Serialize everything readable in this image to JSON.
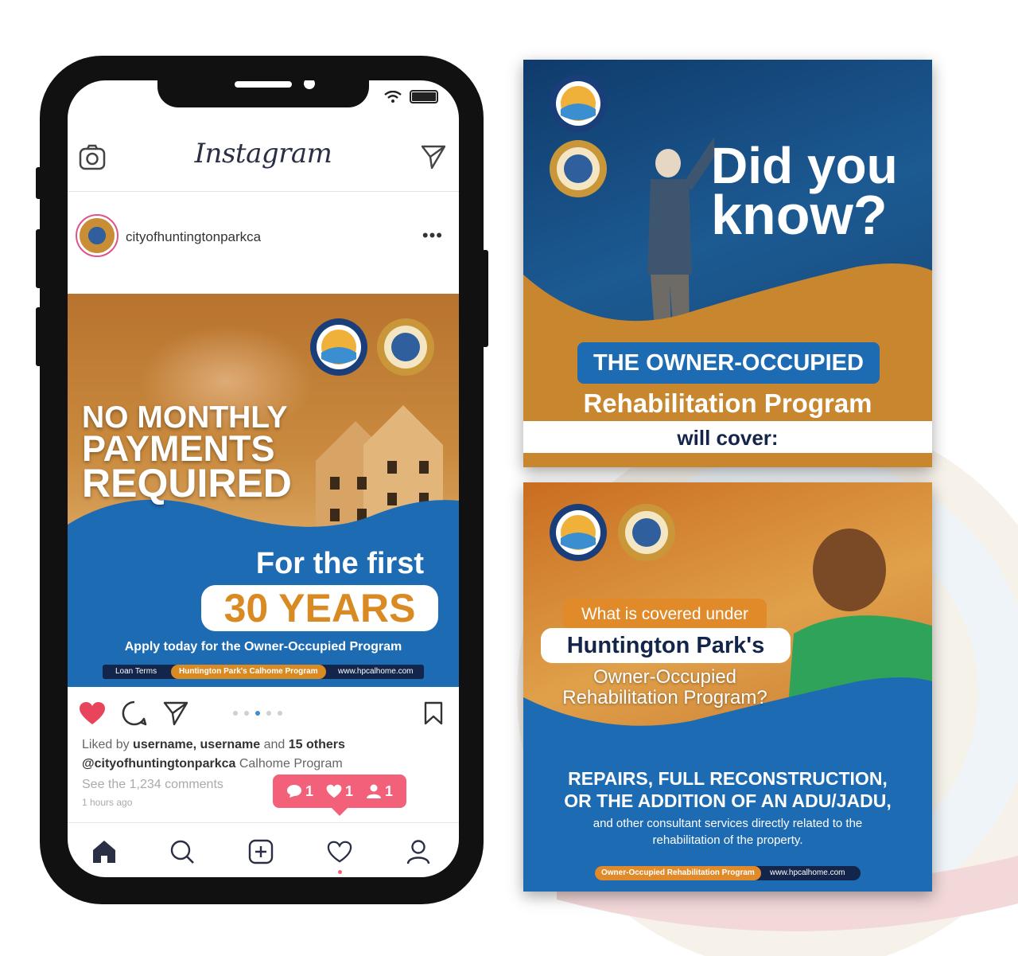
{
  "colors": {
    "brand_blue": "#1d6bb3",
    "brand_orange": "#d98a22",
    "navy": "#13254a",
    "notif_pink": "#f2607a",
    "like_red": "#e8455d"
  },
  "instagram": {
    "logo": "Instagram",
    "username": "cityofhuntingtonparkca",
    "more_icon": "more-dots-icon"
  },
  "post": {
    "title_line1": "NO MONTHLY",
    "title_line2": "PAYMENTS",
    "title_line3": "REQUIRED",
    "for_the_first": "For the first",
    "years": "30 YEARS",
    "apply": "Apply today for the Owner-Occupied Program",
    "footer": [
      "Loan Terms",
      "Huntington Park's Calhome Program",
      "www.hpcalhome.com"
    ]
  },
  "engagement": {
    "liked_prefix": "Liked by ",
    "liked_users": "username, username",
    "liked_and": " and ",
    "liked_others": "15 others",
    "caption_user": "@cityofhuntingtonparkca",
    "caption_text": " Calhome Program",
    "comments": "See the 1,234 comments",
    "time": "1 hours ago",
    "carousel_active_index": 2,
    "notif_comments": "1",
    "notif_likes": "1",
    "notif_follows": "1"
  },
  "card1": {
    "headline_1": "Did you",
    "headline_2": "know?",
    "pill": "THE OWNER-OCCUPIED",
    "subhead": "Rehabilitation Program",
    "cover": "will cover:"
  },
  "card2": {
    "pill1": "What is covered under",
    "pill2": "Huntington Park's",
    "sub_1": "Owner-Occupied",
    "sub_2": "Rehabilitation Program?",
    "repairs_1": "REPAIRS, FULL RECONSTRUCTION,",
    "repairs_2": "OR THE ADDITION OF AN ADU/JADU,",
    "other_1": "and other consultant services directly related to the",
    "other_2": "rehabilitation of the property.",
    "footer_program": "Owner-Occupied Rehabilitation Program",
    "footer_url": "www.hpcalhome.com"
  }
}
